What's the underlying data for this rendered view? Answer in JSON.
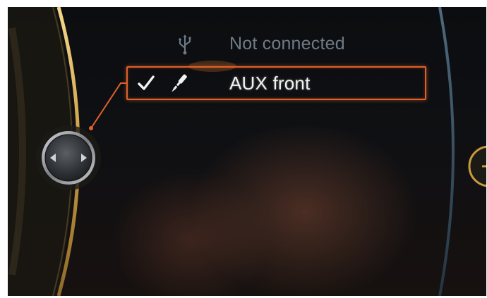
{
  "sources": [
    {
      "label": "Not connected",
      "icon": "usb-icon",
      "selected": false
    },
    {
      "label": "AUX front",
      "icon": "audio-jack-icon",
      "selected": true
    }
  ],
  "colors": {
    "accent_orange": "#e0602c",
    "chrome_gold": "#d8b25a",
    "inactive_text": "#6e7b86",
    "active_text": "#f2f2f2",
    "background": "#0f1013"
  },
  "icons": {
    "selected_check": "check-icon",
    "controller": "controller-knob-icon",
    "right_control": "plus-icon"
  }
}
